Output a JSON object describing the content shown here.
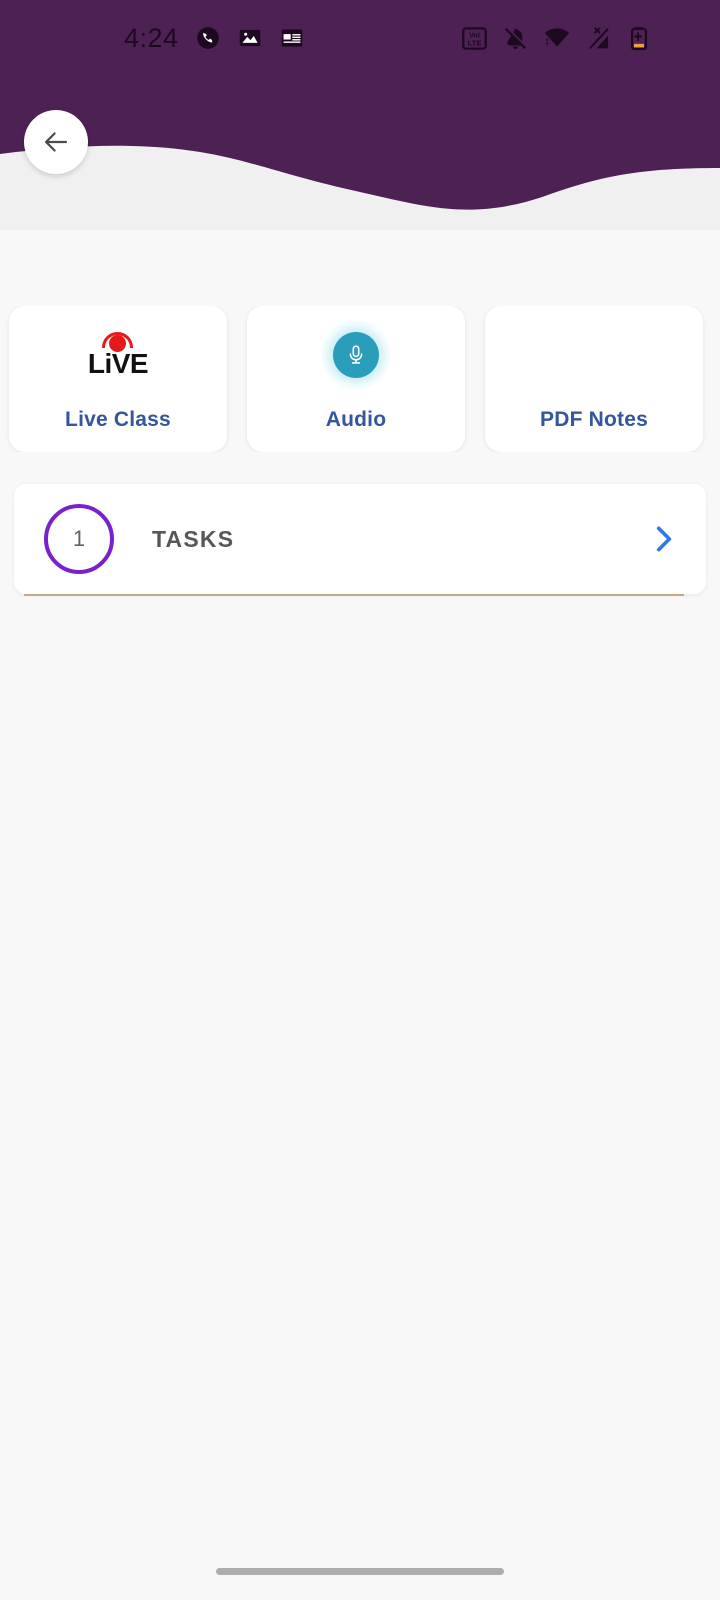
{
  "theme": {
    "header_purple": "#4e2154",
    "page_bg": "#f8f8f8",
    "header_bg_band": "#f0f0f0",
    "card_label_blue": "#35559e",
    "accent_purple": "#7a21ce",
    "chevron_blue": "#2b7be0",
    "mic_teal": "#2a9dbb",
    "live_red": "#e8191a",
    "underline_tan": "#c89a77",
    "home_bar_gray": "#adadad"
  },
  "status_bar": {
    "time": "4:24",
    "left_icons": [
      {
        "name": "call-recorder-icon",
        "glyph": "phone-circle"
      },
      {
        "name": "gallery-image-icon",
        "glyph": "photo"
      },
      {
        "name": "news-calendar-icon",
        "glyph": "news"
      }
    ],
    "right_icons": [
      {
        "name": "volte-icon",
        "label_top": "VoI",
        "label_bottom": "LTE"
      },
      {
        "name": "notifications-muted-icon",
        "glyph": "bell-slash"
      },
      {
        "name": "wifi-icon",
        "glyph": "wifi"
      },
      {
        "name": "mobile-signal-off-icon",
        "glyph": "signal-x"
      },
      {
        "name": "battery-icon",
        "glyph": "battery-low"
      }
    ]
  },
  "header": {
    "back_button_label": "Back"
  },
  "action_cards": [
    {
      "id": "live-class",
      "label": "Live Class",
      "icon": "live-badge-icon",
      "live_text": "LiVE"
    },
    {
      "id": "audio",
      "label": "Audio",
      "icon": "microphone-icon"
    },
    {
      "id": "pdf-notes",
      "label": "PDF Notes",
      "icon": "none"
    }
  ],
  "tasks_row": {
    "count": "1",
    "title": "TASKS",
    "chevron": "chevron-right-icon"
  }
}
